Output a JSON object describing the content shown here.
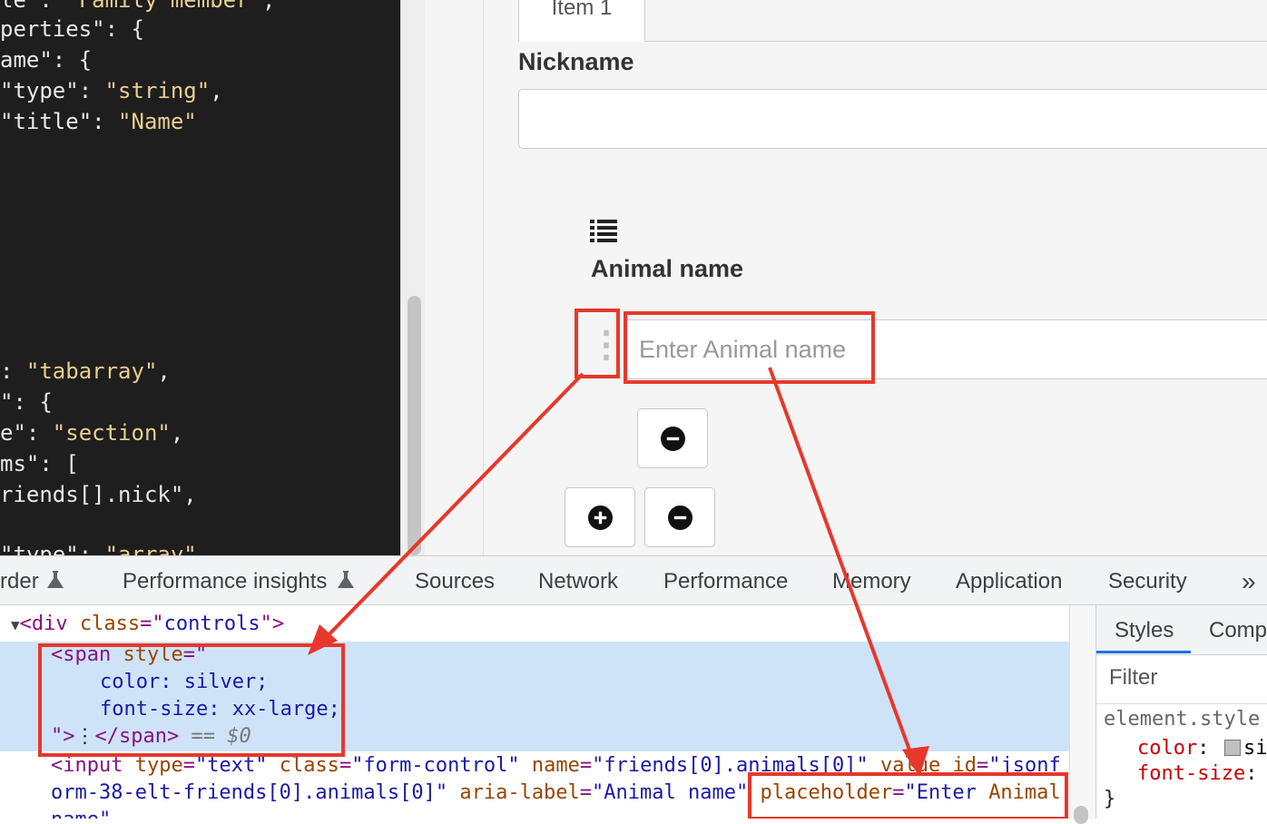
{
  "code_lines": [
    {
      "pre": "le\": ",
      "str": "\"Family member\"",
      "post": ","
    },
    {
      "pre": "perties\": {",
      "str": "",
      "post": ""
    },
    {
      "pre": "ame\": {",
      "str": "",
      "post": ""
    },
    {
      "pre": "\"type\": ",
      "str": "\"string\"",
      "post": ","
    },
    {
      "pre": "\"title\": ",
      "str": "\"Name\"",
      "post": ""
    },
    {
      "pre": ": ",
      "str": "\"tabarray\"",
      "post": ","
    },
    {
      "pre": "\": {",
      "str": "",
      "post": ""
    },
    {
      "pre": "e\": ",
      "str": "\"section\"",
      "post": ","
    },
    {
      "pre": "ms\": [",
      "str": "",
      "post": ""
    },
    {
      "pre": "riends[].nick\",",
      "str": "",
      "post": ""
    },
    {
      "pre": "\"type\": ",
      "str": "\"array\"",
      "post": ","
    }
  ],
  "form": {
    "tab_label": "Item 1",
    "nickname_label": "Nickname",
    "animal_label": "Animal name",
    "animal_placeholder": "Enter Animal name",
    "drag_handle": "⋮",
    "icons": [
      "list-icon",
      "minus-circle-icon",
      "plus-circle-icon"
    ]
  },
  "devtools": {
    "tabs": [
      "rder",
      "Performance insights",
      "Sources",
      "Network",
      "Performance",
      "Memory",
      "Application",
      "Security",
      "»"
    ],
    "lab_icon": "flask-icon",
    "elements": {
      "line1_tag": "<div ",
      "line1_attr": "class",
      "line1_eq": "=\"",
      "line1_val": "controls",
      "line1_end": "\">",
      "span_open": "<span ",
      "span_attr": "style",
      "span_eq": "=\"",
      "style_line1": "color: silver;",
      "style_line2": "font-size: xx-large;",
      "span_close_q": "\">",
      "span_text": "⋮",
      "span_close": "</span>",
      "selected_marker": " == $0",
      "input_line1": "<input type=\"text\" class=\"form-control\" name=\"friends[0].animals[0]\" value id=\"jsonf",
      "input_line2a": "orm-38-elt-friends[0].animals[0]\" aria-label=\"Animal name\" ",
      "input_line2b": "placeholder=\"Enter Animal",
      "input_line3": "name\""
    }
  },
  "styles_pane": {
    "tabs": [
      "Styles",
      "Comp"
    ],
    "filter_placeholder": "Filter",
    "selector": "element.style {",
    "prop1": "color",
    "prop1_val": "si",
    "prop2": "font-size",
    "closing": "}"
  },
  "colors": {
    "annotation": "#e8372b",
    "selection": "#cfe3f8",
    "code_bg": "#1e1e1e"
  }
}
